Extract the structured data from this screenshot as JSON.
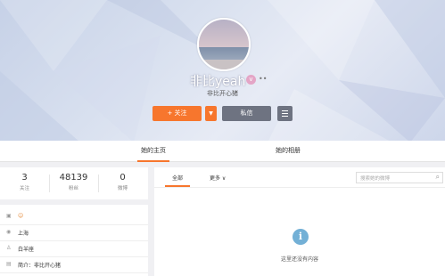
{
  "header": {
    "username": "非比yeah",
    "verified_icon": "verified-badge-icon",
    "bio": "非比开心猪"
  },
  "actions": {
    "follow_label": "+ 关注",
    "more_icon": "caret-down-icon",
    "message_label": "私信",
    "menu_icon": "hamburger-menu-icon"
  },
  "tabs": [
    {
      "label": "她的主页",
      "active": true
    },
    {
      "label": "她的相册",
      "active": false
    }
  ],
  "stats": [
    {
      "value": "3",
      "label": "关注"
    },
    {
      "value": "48139",
      "label": "粉丝"
    },
    {
      "value": "0",
      "label": "微博"
    }
  ],
  "info": [
    {
      "icon": "id-card-icon",
      "text": "☺"
    },
    {
      "icon": "location-icon",
      "text": "上海"
    },
    {
      "icon": "user-icon",
      "text": "白羊座"
    },
    {
      "icon": "intro-icon",
      "text": "简介：非比开心猪"
    }
  ],
  "feed": {
    "tabs": [
      {
        "label": "全部",
        "active": true
      },
      {
        "label": "更多 ∨",
        "active": false
      }
    ],
    "search_placeholder": "搜索她的微博",
    "empty_text": "这里还没有内容"
  },
  "colors": {
    "accent": "#f7762d",
    "secondary_button": "#6e7381",
    "info_icon": "#73b0d6"
  }
}
